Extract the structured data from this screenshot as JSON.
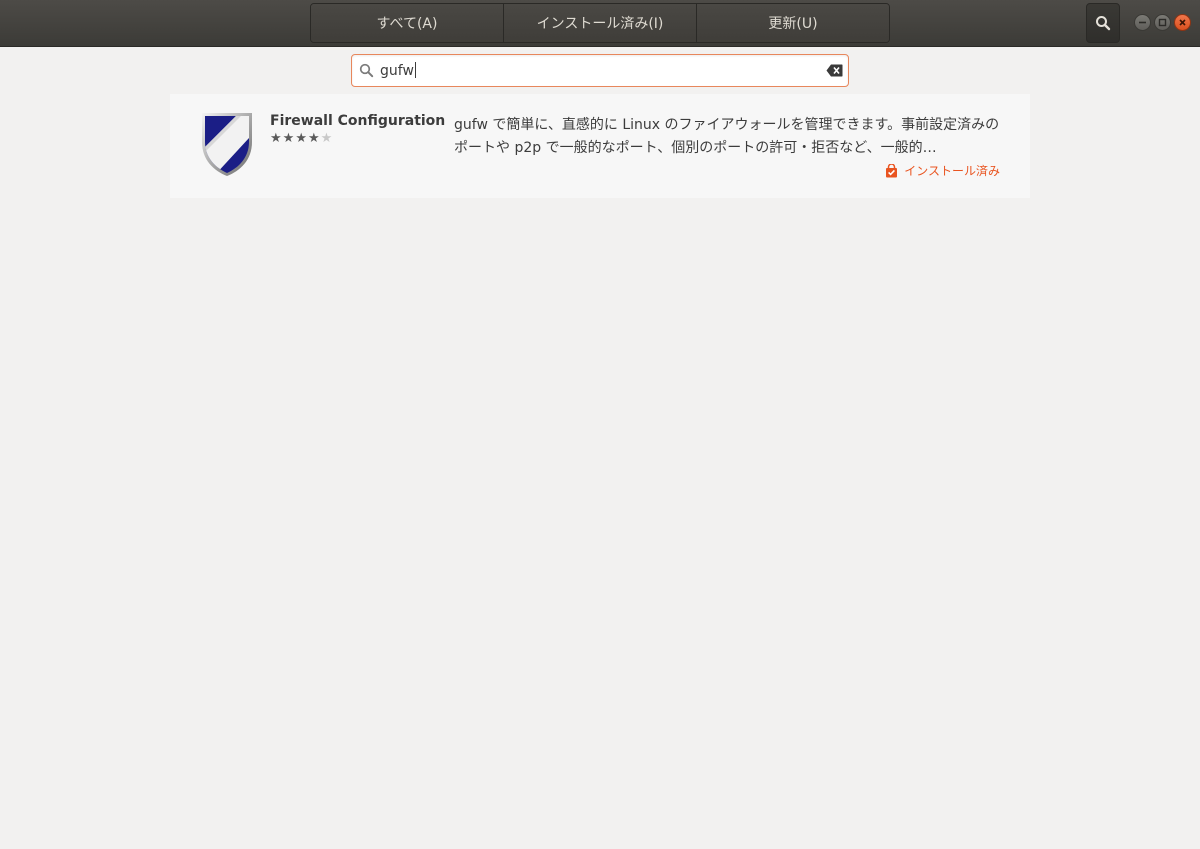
{
  "header": {
    "tabs": [
      {
        "label": "すべて(A)",
        "active": false
      },
      {
        "label": "インストール済み(I)",
        "active": false
      },
      {
        "label": "更新(U)",
        "active": false
      }
    ],
    "search_icon": "magnifier-icon",
    "window_controls": [
      "minimize-icon",
      "maximize-icon",
      "close-icon"
    ]
  },
  "search": {
    "value": "gufw",
    "clear_icon": "backspace-clear-icon"
  },
  "results": [
    {
      "name": "Firewall Configuration",
      "rating": 4,
      "rating_max": 5,
      "description": "gufw で簡単に、直感的に Linux のファイアウォールを管理できます。事前設定済みのポートや p2p で一般的なポート、個別のポートの許可・拒否など、一般的…",
      "status": "インストール済み",
      "icon": "shield-icon"
    }
  ],
  "colors": {
    "accent": "#e95420",
    "header_bg": "#3c3b37",
    "page_bg": "#f2f1f0",
    "shield_blue": "#1b1e86"
  }
}
